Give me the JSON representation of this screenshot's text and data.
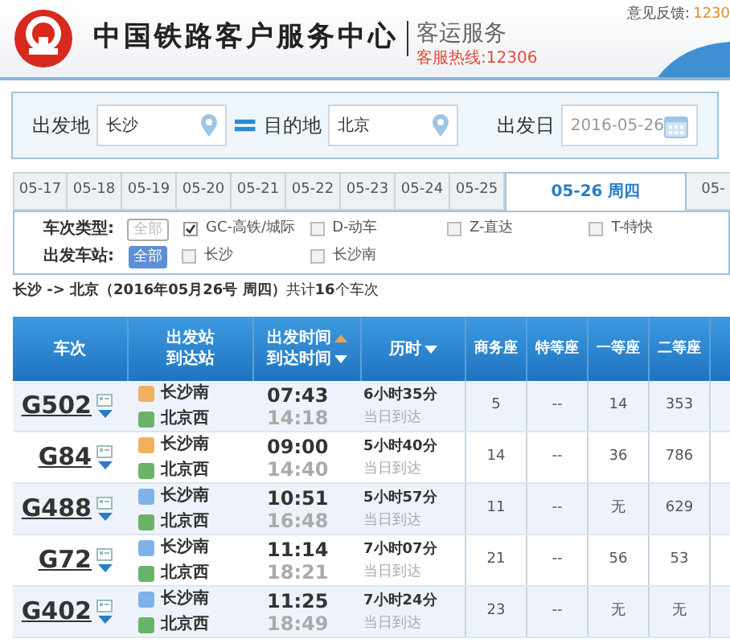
{
  "header": {
    "org_title": "中国铁路客户服务中心",
    "service_title": "客运服务",
    "hotline": "客服热线:12306",
    "feedback_label": "意见反馈:",
    "feedback_value": "1230"
  },
  "search": {
    "from_label": "出发地",
    "from_value": "长沙",
    "to_label": "目的地",
    "to_value": "北京",
    "date_label": "出发日",
    "date_value": "2016-05-26"
  },
  "date_tabs": [
    {
      "label": "05-17",
      "selected": false
    },
    {
      "label": "05-18",
      "selected": false
    },
    {
      "label": "05-19",
      "selected": false
    },
    {
      "label": "05-20",
      "selected": false
    },
    {
      "label": "05-21",
      "selected": false
    },
    {
      "label": "05-22",
      "selected": false
    },
    {
      "label": "05-23",
      "selected": false
    },
    {
      "label": "05-24",
      "selected": false
    },
    {
      "label": "05-25",
      "selected": false
    },
    {
      "label": "05-26 周四",
      "selected": true
    },
    {
      "label": "05-",
      "selected": false
    }
  ],
  "filters": [
    {
      "label": "车次类型:",
      "all_label": "全部",
      "all_selected": false,
      "options": [
        {
          "label": "GC-高铁/城际",
          "checked": true
        },
        {
          "label": "D-动车",
          "checked": false
        },
        {
          "label": "Z-直达",
          "checked": false
        },
        {
          "label": "T-特快",
          "checked": false
        }
      ]
    },
    {
      "label": "出发车站:",
      "all_label": "全部",
      "all_selected": true,
      "options": [
        {
          "label": "长沙",
          "checked": false
        },
        {
          "label": "长沙南",
          "checked": false
        }
      ]
    }
  ],
  "summary": "**长沙 -> 北京（2016年05月26号  周四）**共计**16**个车次",
  "table": {
    "columns": [
      {
        "lines": [
          {
            "label": "车次",
            "sort_up": false,
            "sort_down": false
          }
        ]
      },
      {
        "lines": [
          {
            "label": "出发站",
            "sort_up": false,
            "sort_down": false
          },
          {
            "label": "到达站",
            "sort_up": false,
            "sort_down": false
          }
        ]
      },
      {
        "lines": [
          {
            "label": "出发时间",
            "sort_up": true,
            "sort_down": false
          },
          {
            "label": "到达时间",
            "sort_up": false,
            "sort_down": true
          }
        ]
      },
      {
        "lines": [
          {
            "label": "历时",
            "sort_up": false,
            "sort_down": true
          }
        ]
      },
      {
        "lines": [
          {
            "label": "商务座",
            "sort_up": false,
            "sort_down": false
          }
        ]
      },
      {
        "lines": [
          {
            "label": "特等座",
            "sort_up": false,
            "sort_down": false
          }
        ]
      },
      {
        "lines": [
          {
            "label": "一等座",
            "sort_up": false,
            "sort_down": false
          }
        ]
      },
      {
        "lines": [
          {
            "label": "二等座",
            "sort_up": false,
            "sort_down": false
          }
        ]
      }
    ],
    "rows": [
      {
        "train": "G502",
        "from": "长沙南",
        "origin": true,
        "to": "北京西",
        "depart": "07:43",
        "arrive": "14:18",
        "duration": "6小时35分",
        "arrival_day": "当日到达",
        "seats": [
          "5",
          "--",
          "14",
          "353"
        ]
      },
      {
        "train": "G84",
        "from": "长沙南",
        "origin": true,
        "to": "北京西",
        "depart": "09:00",
        "arrive": "14:40",
        "duration": "5小时40分",
        "arrival_day": "当日到达",
        "seats": [
          "14",
          "--",
          "36",
          "786"
        ]
      },
      {
        "train": "G488",
        "from": "长沙南",
        "origin": false,
        "to": "北京西",
        "depart": "10:51",
        "arrive": "16:48",
        "duration": "5小时57分",
        "arrival_day": "当日到达",
        "seats": [
          "11",
          "--",
          "无",
          "629"
        ]
      },
      {
        "train": "G72",
        "from": "长沙南",
        "origin": false,
        "to": "北京西",
        "depart": "11:14",
        "arrive": "18:21",
        "duration": "7小时07分",
        "arrival_day": "当日到达",
        "seats": [
          "21",
          "--",
          "56",
          "53"
        ]
      },
      {
        "train": "G402",
        "from": "长沙南",
        "origin": false,
        "to": "北京西",
        "depart": "11:25",
        "arrive": "18:49",
        "duration": "7小时24分",
        "arrival_day": "当日到达",
        "seats": [
          "23",
          "--",
          "无",
          "无"
        ]
      }
    ]
  }
}
